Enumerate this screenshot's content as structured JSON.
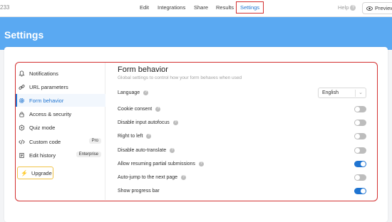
{
  "topbar": {
    "form_id": "233",
    "nav": [
      {
        "label": "Edit"
      },
      {
        "label": "Integrations"
      },
      {
        "label": "Share"
      },
      {
        "label": "Results"
      },
      {
        "label": "Settings",
        "active": true
      }
    ],
    "help_label": "Help",
    "preview_label": "Preview"
  },
  "header": {
    "title": "Settings"
  },
  "sidebar": {
    "items": [
      {
        "label": "Notifications",
        "icon": "bell-icon"
      },
      {
        "label": "URL parameters",
        "icon": "link-icon"
      },
      {
        "label": "Form behavior",
        "icon": "gear-icon",
        "active": true
      },
      {
        "label": "Access & security",
        "icon": "lock-icon"
      },
      {
        "label": "Quiz mode",
        "icon": "quiz-icon"
      },
      {
        "label": "Custom code",
        "icon": "code-icon",
        "badge": "Pro"
      },
      {
        "label": "Edit history",
        "icon": "history-icon",
        "badge": "Enterprise"
      }
    ],
    "upgrade_label": "Upgrade"
  },
  "main": {
    "title": "Form behavior",
    "subtitle": "Global settings to control how your form behaves when used",
    "language": {
      "label": "Language",
      "value": "English"
    },
    "toggles": [
      {
        "label": "Cookie consent",
        "on": false
      },
      {
        "label": "Disable input autofocus",
        "on": false
      },
      {
        "label": "Right to left",
        "on": false
      },
      {
        "label": "Disable auto-translate",
        "on": false
      },
      {
        "label": "Allow resuming partial submissions",
        "on": true
      },
      {
        "label": "Auto-jump to the next page",
        "on": false
      },
      {
        "label": "Show progress bar",
        "on": true
      }
    ]
  },
  "colors": {
    "accent": "#1f74d1",
    "hero": "#5aa9f2",
    "highlight_border": "#d32f2f",
    "toggle_off": "#bdbdbd",
    "upgrade_border": "#f0c247"
  }
}
